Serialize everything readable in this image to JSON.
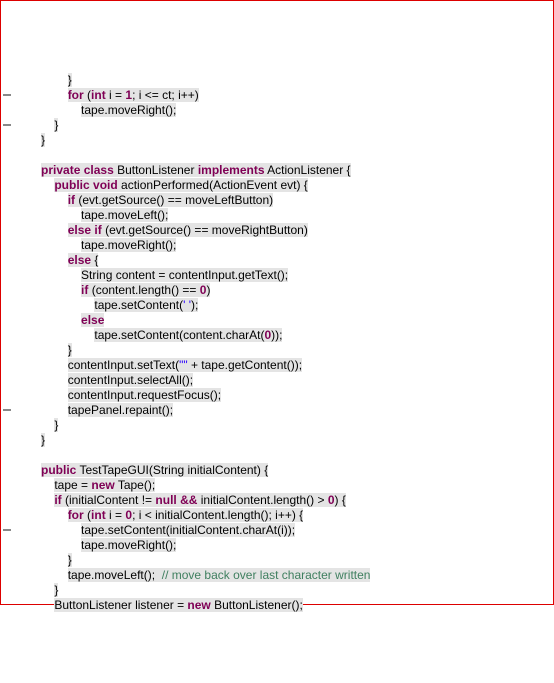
{
  "code": {
    "lines": [
      {
        "indent": 14,
        "tokens": [
          {
            "t": "plain",
            "v": "}"
          }
        ]
      },
      {
        "indent": 14,
        "tokens": [
          {
            "t": "kw",
            "v": "for"
          },
          {
            "t": "plain",
            "v": " ("
          },
          {
            "t": "kw",
            "v": "int"
          },
          {
            "t": "plain",
            "v": " i = "
          },
          {
            "t": "num",
            "v": "1"
          },
          {
            "t": "plain",
            "v": "; i <= ct; i++)"
          }
        ]
      },
      {
        "indent": 18,
        "tokens": [
          {
            "t": "plain",
            "v": "tape.moveRight();"
          }
        ]
      },
      {
        "indent": 10,
        "tokens": [
          {
            "t": "plain",
            "v": "}"
          }
        ]
      },
      {
        "indent": 6,
        "tokens": [
          {
            "t": "plain",
            "v": "}"
          }
        ]
      },
      {
        "indent": 0,
        "tokens": []
      },
      {
        "indent": 6,
        "tokens": [
          {
            "t": "kw",
            "v": "private"
          },
          {
            "t": "plain",
            "v": " "
          },
          {
            "t": "kw",
            "v": "class"
          },
          {
            "t": "plain",
            "v": " ButtonListener "
          },
          {
            "t": "kw",
            "v": "implements"
          },
          {
            "t": "plain",
            "v": " ActionListener {"
          }
        ]
      },
      {
        "indent": 10,
        "tokens": [
          {
            "t": "kw",
            "v": "public"
          },
          {
            "t": "plain",
            "v": " "
          },
          {
            "t": "kw",
            "v": "void"
          },
          {
            "t": "plain",
            "v": " actionPerformed(ActionEvent evt) {"
          }
        ]
      },
      {
        "indent": 14,
        "tokens": [
          {
            "t": "kw",
            "v": "if"
          },
          {
            "t": "plain",
            "v": " (evt.getSource() == moveLeftButton)"
          }
        ]
      },
      {
        "indent": 18,
        "tokens": [
          {
            "t": "plain",
            "v": "tape.moveLeft();"
          }
        ]
      },
      {
        "indent": 14,
        "tokens": [
          {
            "t": "kw",
            "v": "else"
          },
          {
            "t": "plain",
            "v": " "
          },
          {
            "t": "kw",
            "v": "if"
          },
          {
            "t": "plain",
            "v": " (evt.getSource() == moveRightButton)"
          }
        ]
      },
      {
        "indent": 18,
        "tokens": [
          {
            "t": "plain",
            "v": "tape.moveRight();"
          }
        ]
      },
      {
        "indent": 14,
        "tokens": [
          {
            "t": "kw",
            "v": "else"
          },
          {
            "t": "plain",
            "v": " {"
          }
        ]
      },
      {
        "indent": 18,
        "tokens": [
          {
            "t": "plain",
            "v": "String content = contentInput.getText();"
          }
        ]
      },
      {
        "indent": 18,
        "tokens": [
          {
            "t": "kw",
            "v": "if"
          },
          {
            "t": "plain",
            "v": " (content.length() == "
          },
          {
            "t": "num",
            "v": "0"
          },
          {
            "t": "plain",
            "v": ")"
          }
        ]
      },
      {
        "indent": 22,
        "tokens": [
          {
            "t": "plain",
            "v": "tape.setContent("
          },
          {
            "t": "str",
            "v": "' '"
          },
          {
            "t": "plain",
            "v": ");"
          }
        ]
      },
      {
        "indent": 18,
        "tokens": [
          {
            "t": "kw",
            "v": "else"
          }
        ]
      },
      {
        "indent": 22,
        "tokens": [
          {
            "t": "plain",
            "v": "tape.setContent(content.charAt("
          },
          {
            "t": "num",
            "v": "0"
          },
          {
            "t": "plain",
            "v": "));"
          }
        ]
      },
      {
        "indent": 14,
        "tokens": [
          {
            "t": "plain",
            "v": "}"
          }
        ]
      },
      {
        "indent": 14,
        "tokens": [
          {
            "t": "plain",
            "v": "contentInput.setText("
          },
          {
            "t": "str",
            "v": "\"\""
          },
          {
            "t": "plain",
            "v": " + tape.getContent());"
          }
        ]
      },
      {
        "indent": 14,
        "tokens": [
          {
            "t": "plain",
            "v": "contentInput.selectAll();"
          }
        ]
      },
      {
        "indent": 14,
        "tokens": [
          {
            "t": "plain",
            "v": "contentInput.requestFocus();"
          }
        ]
      },
      {
        "indent": 14,
        "tokens": [
          {
            "t": "plain",
            "v": "tapePanel.repaint();"
          }
        ]
      },
      {
        "indent": 10,
        "tokens": [
          {
            "t": "plain",
            "v": "}"
          }
        ]
      },
      {
        "indent": 6,
        "tokens": [
          {
            "t": "plain",
            "v": "}"
          }
        ]
      },
      {
        "indent": 0,
        "tokens": []
      },
      {
        "indent": 6,
        "tokens": [
          {
            "t": "kw",
            "v": "public"
          },
          {
            "t": "plain",
            "v": " TestTapeGUI(String initialContent) {"
          }
        ]
      },
      {
        "indent": 10,
        "tokens": [
          {
            "t": "plain",
            "v": "tape = "
          },
          {
            "t": "kw",
            "v": "new"
          },
          {
            "t": "plain",
            "v": " Tape();"
          }
        ]
      },
      {
        "indent": 10,
        "tokens": [
          {
            "t": "kw",
            "v": "if"
          },
          {
            "t": "plain",
            "v": " (initialContent != "
          },
          {
            "t": "kw",
            "v": "null"
          },
          {
            "t": "plain",
            "v": " "
          },
          {
            "t": "kw",
            "v": "&&"
          },
          {
            "t": "plain",
            "v": " initialContent.length() > "
          },
          {
            "t": "num",
            "v": "0"
          },
          {
            "t": "plain",
            "v": ") {"
          }
        ]
      },
      {
        "indent": 14,
        "tokens": [
          {
            "t": "kw",
            "v": "for"
          },
          {
            "t": "plain",
            "v": " ("
          },
          {
            "t": "kw",
            "v": "int"
          },
          {
            "t": "plain",
            "v": " i = "
          },
          {
            "t": "num",
            "v": "0"
          },
          {
            "t": "plain",
            "v": "; i < initialContent.length(); i++) {"
          }
        ]
      },
      {
        "indent": 18,
        "tokens": [
          {
            "t": "plain",
            "v": "tape.setContent(initialContent.charAt(i));"
          }
        ]
      },
      {
        "indent": 18,
        "tokens": [
          {
            "t": "plain",
            "v": "tape.moveRight();"
          }
        ]
      },
      {
        "indent": 14,
        "tokens": [
          {
            "t": "plain",
            "v": "}"
          }
        ]
      },
      {
        "indent": 14,
        "tokens": [
          {
            "t": "plain",
            "v": "tape.moveLeft();  "
          },
          {
            "t": "comment",
            "v": "// move back over last character written"
          }
        ]
      },
      {
        "indent": 10,
        "tokens": [
          {
            "t": "plain",
            "v": "}"
          }
        ]
      },
      {
        "indent": 10,
        "tokens": [
          {
            "t": "plain",
            "v": "ButtonListener listener = "
          },
          {
            "t": "kw",
            "v": "new"
          },
          {
            "t": "plain",
            "v": " ButtonListener();"
          }
        ]
      }
    ]
  },
  "gutter_marks": [
    93,
    123,
    408,
    528
  ],
  "indent_unit": 8,
  "highlight_all": true
}
